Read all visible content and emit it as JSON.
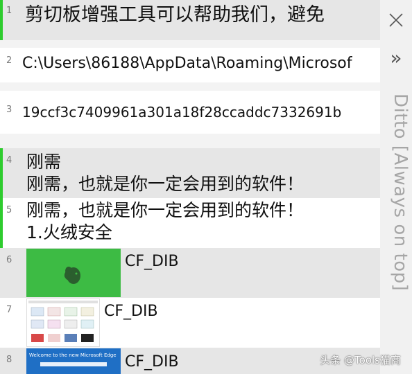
{
  "window": {
    "title": "Ditto [Always on top]",
    "close_icon": "close-icon",
    "expand_icon": "double-chevron-right-icon",
    "expand_glyph": "»"
  },
  "colors": {
    "accent_green": "#2ecc2e",
    "selected_row": "#e6e6e6",
    "row_bg": "#ffffff"
  },
  "clips": [
    {
      "num": "1",
      "text": "剪切板增强工具可以帮助我们，避免"
    },
    {
      "num": "2",
      "text": "C:\\Users\\86188\\AppData\\Roaming\\Microsof"
    },
    {
      "num": "3",
      "text": "19ccf3c7409961a301a18f28ccaddc7332691b"
    },
    {
      "num": "4",
      "line1": "刚需",
      "line2": "刚需，也就是你一定会用到的软件！"
    },
    {
      "num": "5",
      "line1": "刚需，也就是你一定会用到的软件！",
      "line2": "1.火绒安全"
    },
    {
      "num": "6",
      "format": "CF_DIB"
    },
    {
      "num": "7",
      "format": "CF_DIB"
    },
    {
      "num": "8",
      "format": "CF_DIB",
      "thumb_caption": "Welcome to the new Microsoft Edge"
    }
  ],
  "watermark": "头条 @Tools猫商"
}
